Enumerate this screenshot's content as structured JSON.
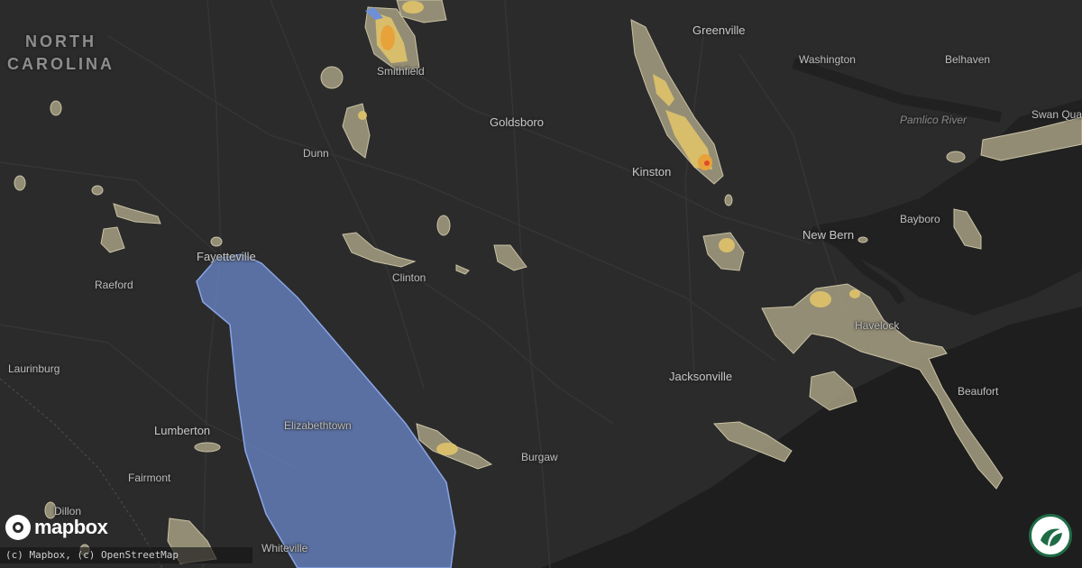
{
  "map": {
    "state_label": [
      "NORTH",
      "CAROLINA"
    ],
    "cities": [
      {
        "key": "greenville",
        "name": "Greenville"
      },
      {
        "key": "washington",
        "name": "Washington"
      },
      {
        "key": "belhaven",
        "name": "Belhaven"
      },
      {
        "key": "smithfield",
        "name": "Smithfield"
      },
      {
        "key": "goldsboro",
        "name": "Goldsboro"
      },
      {
        "key": "kinston",
        "name": "Kinston"
      },
      {
        "key": "dunn",
        "name": "Dunn"
      },
      {
        "key": "swan_quarter",
        "name": "Swan Quar"
      },
      {
        "key": "bayboro",
        "name": "Bayboro"
      },
      {
        "key": "new_bern",
        "name": "New Bern"
      },
      {
        "key": "fayetteville",
        "name": "Fayetteville"
      },
      {
        "key": "raeford",
        "name": "Raeford"
      },
      {
        "key": "clinton",
        "name": "Clinton"
      },
      {
        "key": "havelock",
        "name": "Havelock"
      },
      {
        "key": "laurinburg",
        "name": "Laurinburg"
      },
      {
        "key": "jacksonville",
        "name": "Jacksonville"
      },
      {
        "key": "beaufort",
        "name": "Beaufort"
      },
      {
        "key": "elizabethtown",
        "name": "Elizabethtown"
      },
      {
        "key": "lumberton",
        "name": "Lumberton"
      },
      {
        "key": "burgaw",
        "name": "Burgaw"
      },
      {
        "key": "fairmont",
        "name": "Fairmont"
      },
      {
        "key": "dillon",
        "name": "Dillon"
      },
      {
        "key": "whiteville",
        "name": "Whiteville"
      }
    ],
    "water": [
      {
        "key": "pamlico",
        "name": "Pamlico River"
      }
    ]
  },
  "logo": {
    "text": "mapbox",
    "icon": "mapbox-logo-icon"
  },
  "attribution": "(c) Mapbox, (c) OpenStreetMap",
  "badge": {
    "icon": "brand-wave-icon"
  },
  "colors": {
    "land": "#2b2b2b",
    "ocean": "#1e1e1e",
    "hail_zone": "#6f8fd6",
    "storm_light": "#a69f83",
    "storm_moderate": "#e0c36a",
    "storm_heavy": "#e8a23a",
    "storm_severe": "#e04a2a"
  }
}
